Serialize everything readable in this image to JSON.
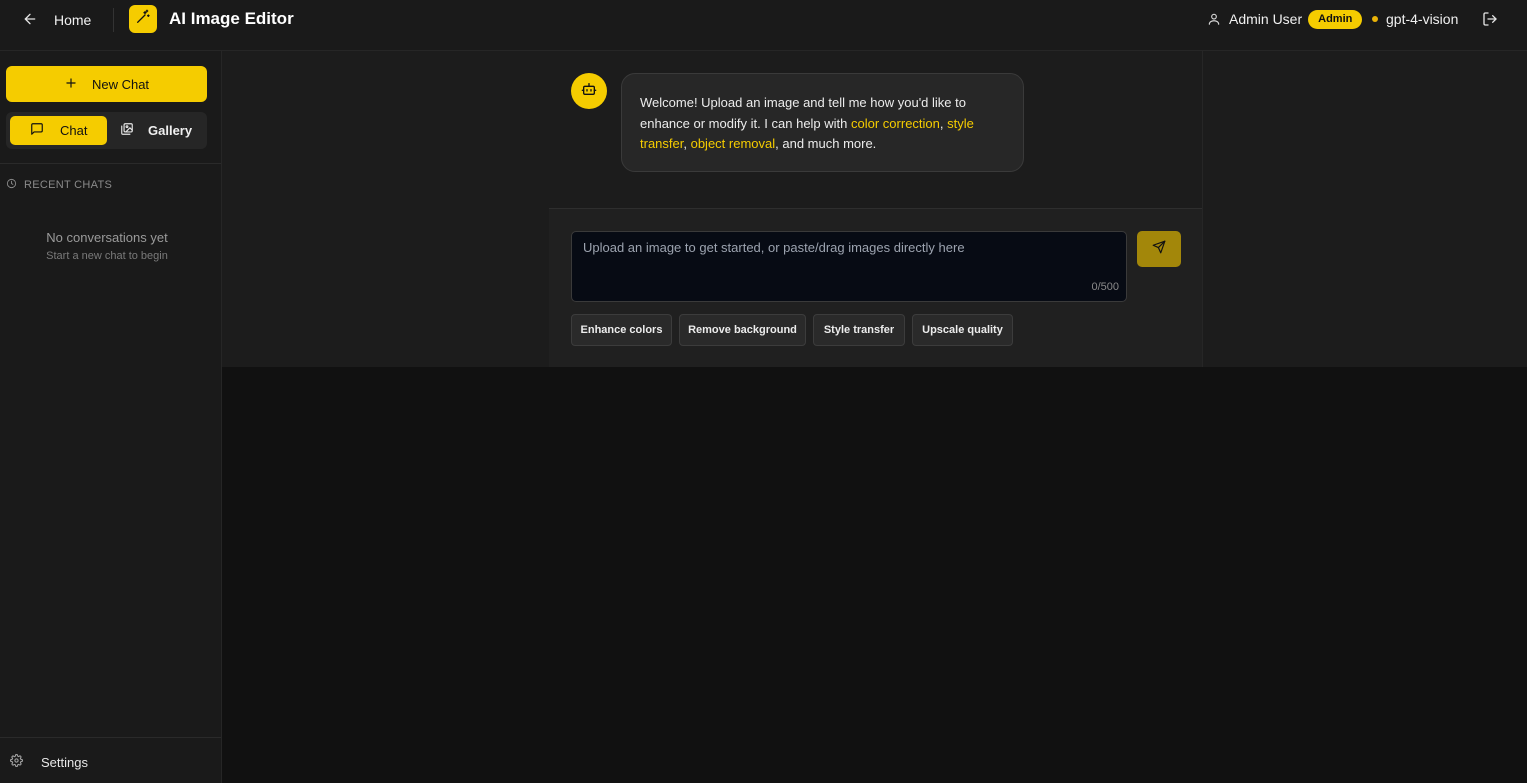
{
  "header": {
    "home_label": "Home",
    "app_title": "AI Image Editor",
    "user_name": "Admin User",
    "role_badge": "Admin",
    "model_name": "gpt-4-vision",
    "status_color": "#eab308"
  },
  "sidebar": {
    "new_chat_label": "New Chat",
    "tabs": [
      {
        "label": "Chat",
        "active": true,
        "icon": "message-square-icon"
      },
      {
        "label": "Gallery",
        "active": false,
        "icon": "images-icon"
      }
    ],
    "recent_header": "RECENT CHATS",
    "empty_title": "No conversations yet",
    "empty_subtitle": "Start a new chat to begin",
    "settings_label": "Settings"
  },
  "chat": {
    "welcome": {
      "intro": "Welcome! Upload an image and tell me how you'd like to enhance or modify it. I can help with ",
      "highlight_1": "color correction",
      "sep_1": ", ",
      "highlight_2": "style transfer",
      "sep_2": ", ",
      "highlight_3": "object removal",
      "outro": ", and much more."
    }
  },
  "composer": {
    "placeholder": "Upload an image to get started, or paste/drag images directly here",
    "value": "",
    "char_count": "0/500",
    "suggestions": [
      "Enhance colors",
      "Remove background",
      "Style transfer",
      "Upscale quality"
    ]
  },
  "colors": {
    "accent": "#f5cc00",
    "background": "#111111",
    "panel": "#1a1a1a"
  }
}
